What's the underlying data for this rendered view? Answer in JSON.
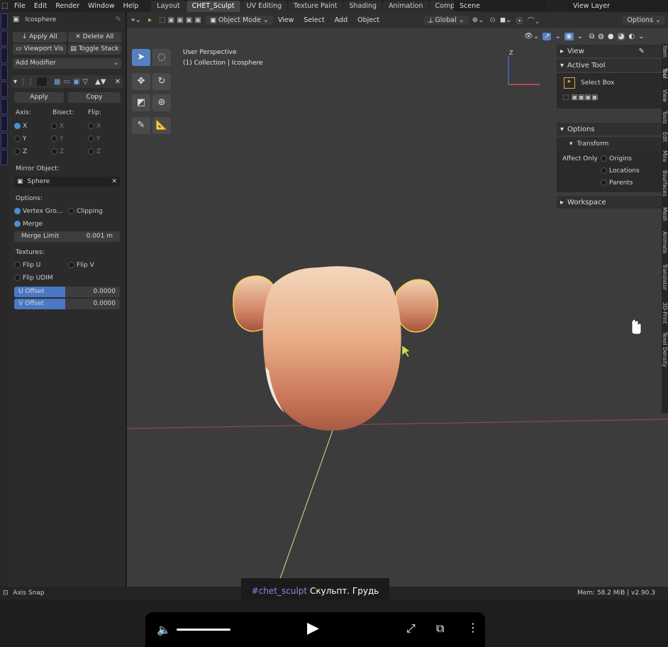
{
  "topbar": {
    "menu": [
      "File",
      "Edit",
      "Render",
      "Window",
      "Help"
    ],
    "workspaces": [
      "Layout",
      "CHET_Sculpt",
      "UV Editing",
      "Texture Paint",
      "Shading",
      "Animation",
      "Compositing"
    ],
    "active_workspace": "CHET_Sculpt",
    "scene": "Scene",
    "view_layer": "View Layer"
  },
  "properties": {
    "object_name": "Icosphere",
    "apply_all": "Apply All",
    "delete_all": "Delete All",
    "viewport_vis": "Viewport Vis",
    "toggle_stack": "Toggle Stack",
    "add_modifier": "Add Modifier",
    "apply": "Apply",
    "copy": "Copy",
    "axis_label": "Axis:",
    "bisect_label": "Bisect:",
    "flip_label": "Flip:",
    "axis_x": "X",
    "axis_y": "Y",
    "axis_z": "Z",
    "mirror_object_label": "Mirror Object:",
    "mirror_object": "Sphere",
    "options_label": "Options:",
    "vertex_groups": "Vertex Gro...",
    "clipping": "Clipping",
    "merge": "Merge",
    "merge_limit_label": "Merge Limit",
    "merge_limit_value": "0.001 m",
    "textures_label": "Textures:",
    "flip_u": "Flip U",
    "flip_v": "Flip V",
    "flip_udim": "Flip UDIM",
    "u_offset_label": "U Offset",
    "u_offset_value": "0.0000",
    "v_offset_label": "V Offset",
    "v_offset_value": "0.0000"
  },
  "viewport": {
    "mode": "Object Mode",
    "menu": [
      "View",
      "Select",
      "Add",
      "Object"
    ],
    "orientation": "Global",
    "options": "Options",
    "perspective": "User Perspective",
    "collection": "(1) Collection | Icosphere",
    "gizmo_z": "Z"
  },
  "npanel": {
    "view": "View",
    "active_tool": "Active Tool",
    "select_box": "Select Box",
    "options": "Options",
    "transform": "Transform",
    "affect_only": "Affect Only",
    "origins": "Origins",
    "locations": "Locations",
    "parents": "Parents",
    "workspace": "Workspace",
    "tabs": [
      "Item",
      "Tool",
      "View",
      "Tools",
      "Edit",
      "Mira",
      "Bsurfaces",
      "Mesh",
      "Animate",
      "Translator",
      "3D-Print",
      "Texel Density"
    ]
  },
  "status": {
    "left": "Axis Snap",
    "right": "Mem: 58.2 MiB | v2.90.3"
  },
  "caption": {
    "tag": "#chet_sculpt",
    "text": "Скульпт. Грудь"
  },
  "colors": {
    "accent": "#5680c2",
    "head_skin": "#e8b08e",
    "select_outline": "#f2d14a"
  }
}
